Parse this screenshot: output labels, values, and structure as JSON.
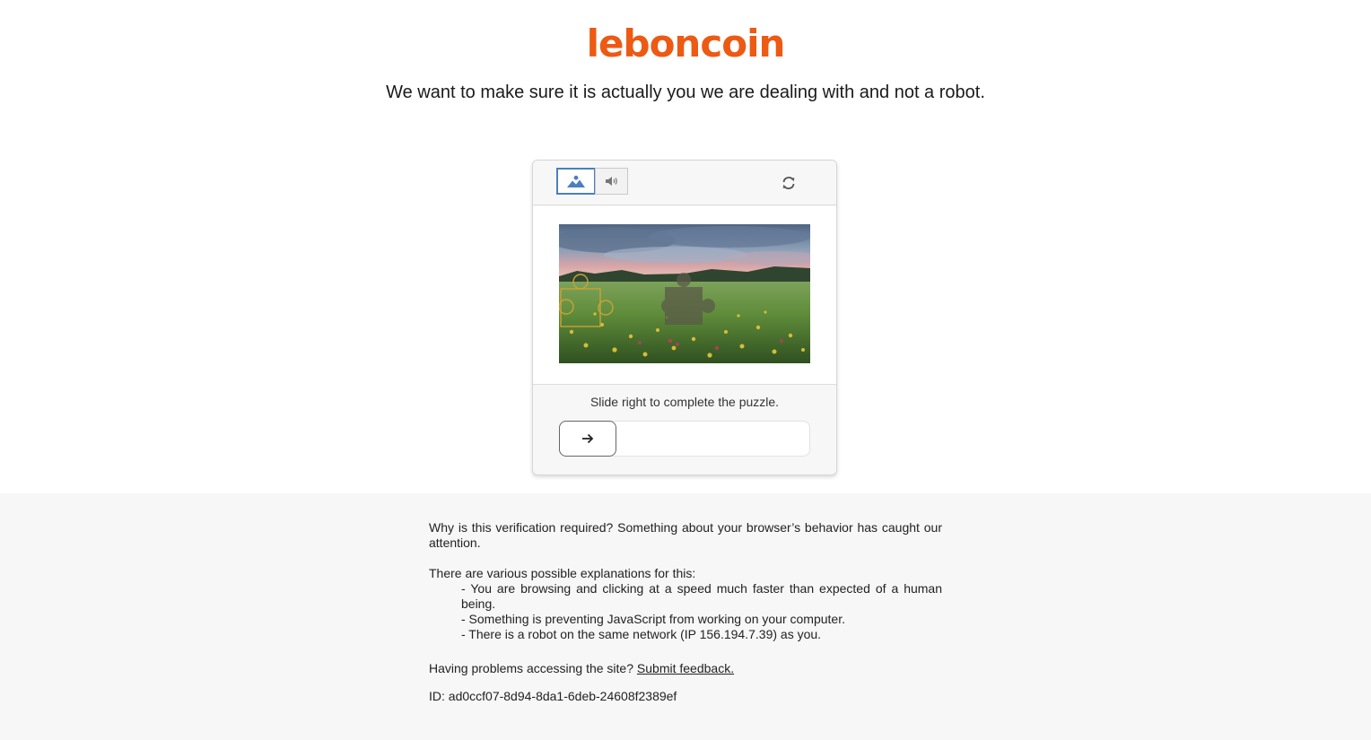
{
  "brand": {
    "logo_text": "leboncoin",
    "color": "#ec5a13"
  },
  "headline": "We want to make sure it is actually you we are dealing with and not a robot.",
  "captcha": {
    "modes": [
      {
        "name": "image-challenge",
        "icon": "image-icon",
        "active": true
      },
      {
        "name": "audio-challenge",
        "icon": "speaker-icon",
        "active": false
      }
    ],
    "refresh_icon": "refresh-icon",
    "instruction": "Slide right to complete the puzzle.",
    "slider_progress": 0,
    "accent_color": "#4a7fc1"
  },
  "info": {
    "why": "Why is this verification required? Something about your browser’s behavior has caught our attention.",
    "explanations_intro": "There are various possible explanations for this:",
    "explanations": [
      "- You are browsing and clicking at a speed much faster than expected of a human being.",
      "- Something is preventing JavaScript from working on your computer.",
      "- There is a robot on the same network (IP 156.194.7.39) as you."
    ],
    "feedback_prefix": "Having problems accessing the site?",
    "feedback_link": "Submit feedback.",
    "id_line": "ID: ad0ccf07-8d94-8da1-6deb-24608f2389ef"
  }
}
